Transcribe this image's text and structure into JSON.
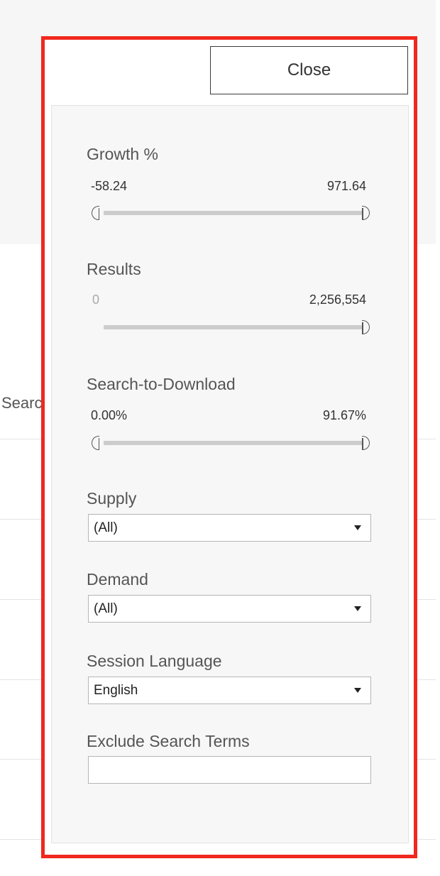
{
  "background": {
    "truncated_column_label": "Search"
  },
  "close_button": {
    "label": "Close"
  },
  "filters": {
    "growth": {
      "title": "Growth %",
      "min": "-58.24",
      "max": "971.64"
    },
    "results": {
      "title": "Results",
      "min": "0",
      "max": "2,256,554"
    },
    "search_to_download": {
      "title": "Search-to-Download",
      "min": "0.00%",
      "max": "91.67%"
    },
    "supply": {
      "title": "Supply",
      "selected": "(All)"
    },
    "demand": {
      "title": "Demand",
      "selected": "(All)"
    },
    "session_language": {
      "title": "Session Language",
      "selected": "English"
    },
    "exclude_search_terms": {
      "title": "Exclude Search Terms",
      "value": "",
      "placeholder": ""
    }
  },
  "colors": {
    "highlight_border": "#f0281e",
    "panel_background": "#f7f7f7",
    "slider_track": "#cccccc"
  }
}
